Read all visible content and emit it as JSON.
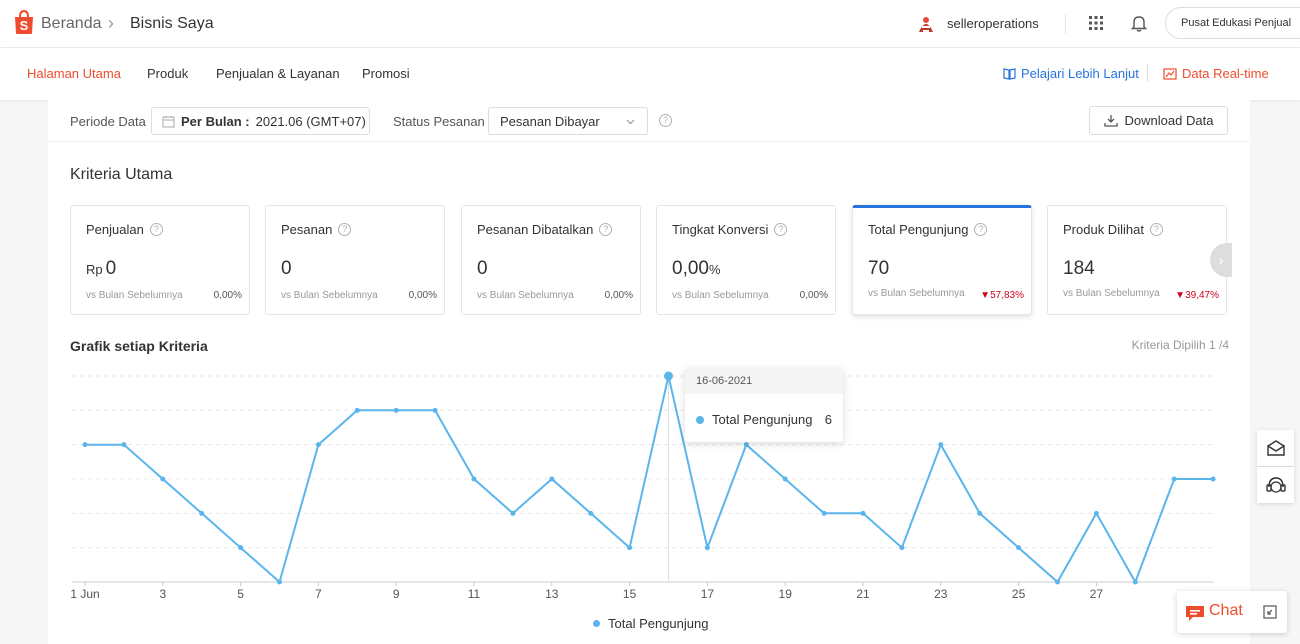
{
  "header": {
    "breadcrumb_home": "Beranda",
    "breadcrumb_sep": "›",
    "breadcrumb_current": "Bisnis Saya",
    "username": "selleroperations",
    "edu_button": "Pusat Edukasi Penjual"
  },
  "nav": {
    "tabs": [
      {
        "label": "Halaman Utama",
        "active": true
      },
      {
        "label": "Produk"
      },
      {
        "label": "Penjualan & Layanan"
      },
      {
        "label": "Promosi"
      }
    ],
    "learn_more": "Pelajari Lebih Lanjut",
    "realtime": "Data Real-time"
  },
  "filter": {
    "period_label": "Periode Data",
    "period_type": "Per Bulan :",
    "period_value": "2021.06 (GMT+07)",
    "status_label": "Status Pesanan",
    "status_value": "Pesanan Dibayar",
    "download": "Download Data"
  },
  "kriteria": {
    "title": "Kriteria Utama",
    "metrics": [
      {
        "label": "Penjualan",
        "prefix": "Rp",
        "value": "0",
        "suffix": "",
        "compare": "vs Bulan Sebelumnya",
        "change": "0,00%",
        "trend": "flat"
      },
      {
        "label": "Pesanan",
        "prefix": "",
        "value": "0",
        "suffix": "",
        "compare": "vs Bulan Sebelumnya",
        "change": "0,00%",
        "trend": "flat"
      },
      {
        "label": "Pesanan Dibatalkan",
        "prefix": "",
        "value": "0",
        "suffix": "",
        "compare": "vs Bulan Sebelumnya",
        "change": "0,00%",
        "trend": "flat"
      },
      {
        "label": "Tingkat Konversi",
        "prefix": "",
        "value": "0,00",
        "suffix": "%",
        "compare": "vs Bulan Sebelumnya",
        "change": "0,00%",
        "trend": "flat"
      },
      {
        "label": "Total Pengunjung",
        "prefix": "",
        "value": "70",
        "suffix": "",
        "compare": "vs Bulan Sebelumnya",
        "change": "57,83%",
        "trend": "down",
        "selected": true
      },
      {
        "label": "Produk Dilihat",
        "prefix": "",
        "value": "184",
        "suffix": "",
        "compare": "vs Bulan Sebelumnya",
        "change": "39,47%",
        "trend": "down"
      }
    ]
  },
  "graph": {
    "title": "Grafik setiap Kriteria",
    "selected_count": "Kriteria Dipilih 1 /4",
    "tooltip_date": "16-06-2021",
    "tooltip_series": "Total Pengunjung",
    "tooltip_value": "6",
    "legend": "Total Pengunjung"
  },
  "chat": {
    "label": "Chat"
  },
  "colors": {
    "accent": "#ee4d2d",
    "link": "#2673dd",
    "series": "#5bb5ed",
    "down": "#d0011b"
  },
  "chart_data": {
    "type": "line",
    "x": [
      1,
      2,
      3,
      4,
      5,
      6,
      7,
      8,
      9,
      10,
      11,
      12,
      13,
      14,
      15,
      16,
      17,
      18,
      19,
      20,
      21,
      22,
      23,
      24,
      25,
      26,
      27,
      28,
      29,
      30
    ],
    "tick_labels": [
      "1 Jun",
      "3",
      "5",
      "7",
      "9",
      "11",
      "13",
      "15",
      "17",
      "19",
      "21",
      "23",
      "25",
      "27"
    ],
    "tick_values": [
      1,
      3,
      5,
      7,
      9,
      11,
      13,
      15,
      17,
      19,
      21,
      23,
      25,
      27
    ],
    "series": [
      {
        "name": "Total Pengunjung",
        "values": [
          4,
          4,
          3,
          2,
          1,
          0,
          4,
          5,
          5,
          5,
          3,
          2,
          3,
          2,
          1,
          6,
          1,
          4,
          3,
          2,
          2,
          1,
          4,
          2,
          1,
          0,
          2,
          0,
          3,
          3
        ]
      }
    ],
    "ylim": [
      0,
      6
    ],
    "grid": true,
    "highlight_index": 15
  }
}
